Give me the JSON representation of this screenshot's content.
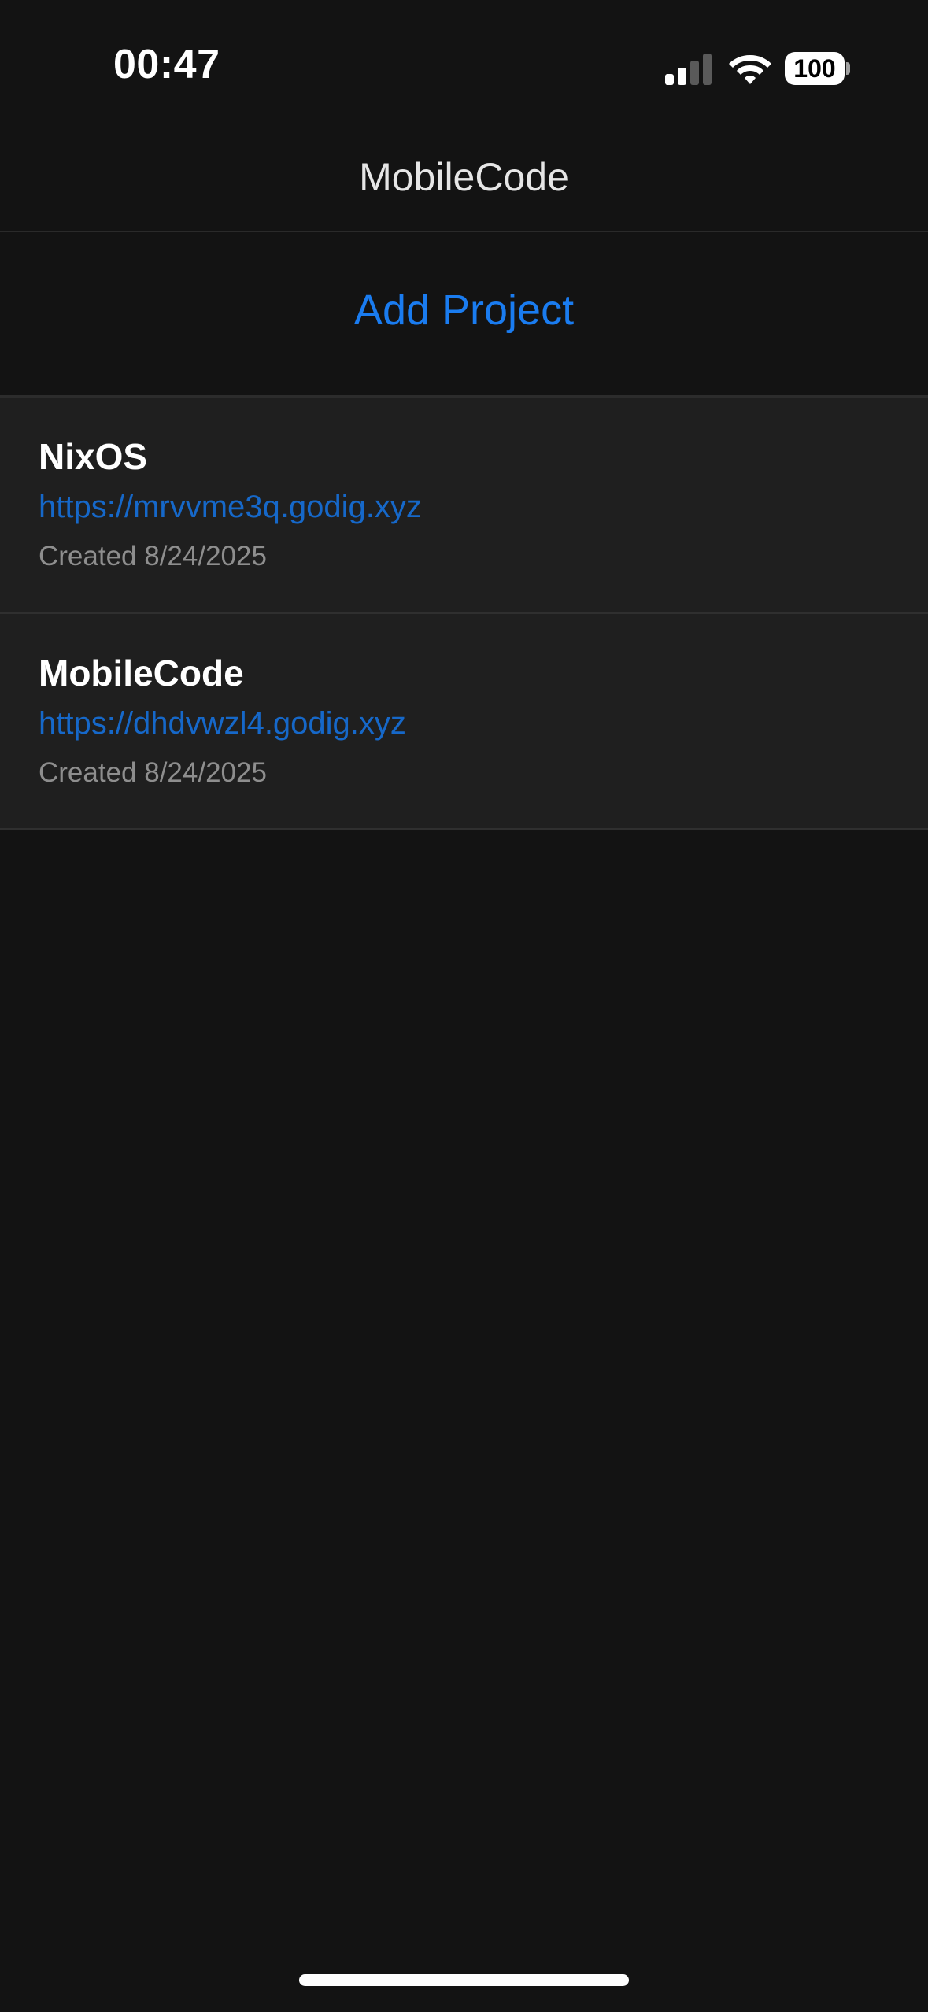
{
  "status_bar": {
    "time": "00:47",
    "battery_level": "100",
    "icons": [
      "cellular-signal-icon",
      "wifi-icon",
      "battery-icon"
    ]
  },
  "nav": {
    "title": "MobileCode"
  },
  "actions": {
    "add_project_label": "Add Project"
  },
  "projects": [
    {
      "name": "NixOS",
      "url": "https://mrvvme3q.godig.xyz",
      "created": "Created 8/24/2025"
    },
    {
      "name": "MobileCode",
      "url": "https://dhdvwzl4.godig.xyz",
      "created": "Created 8/24/2025"
    }
  ],
  "colors": {
    "background": "#131313",
    "row_background": "#1f1f1f",
    "accent": "#1a7cf0",
    "link": "#1668c9",
    "secondary_text": "#8e8e8e"
  }
}
